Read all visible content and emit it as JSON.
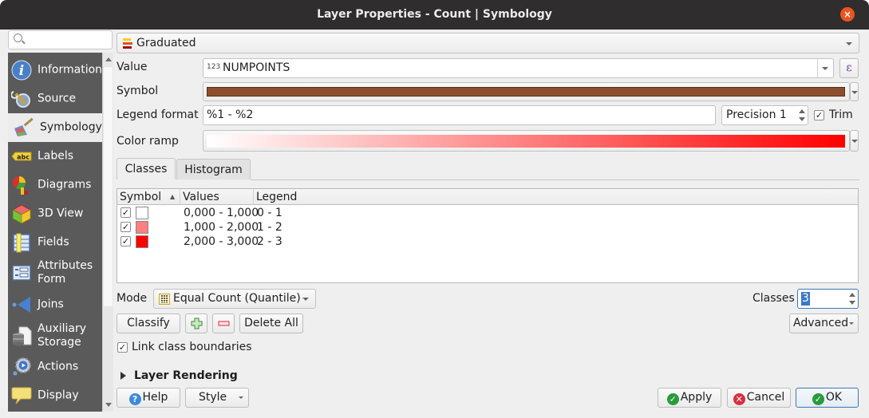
{
  "window": {
    "title": "Layer Properties - Count | Symbology",
    "close_icon": "×"
  },
  "sidebar": {
    "search_placeholder": "",
    "items": [
      {
        "label": "Information",
        "icon": "information-icon"
      },
      {
        "label": "Source",
        "icon": "source-icon"
      },
      {
        "label": "Symbology",
        "icon": "symbology-icon",
        "active": true
      },
      {
        "label": "Labels",
        "icon": "labels-icon"
      },
      {
        "label": "Diagrams",
        "icon": "diagrams-icon"
      },
      {
        "label": "3D View",
        "icon": "3d-view-icon"
      },
      {
        "label": "Fields",
        "icon": "fields-icon"
      },
      {
        "label": "Attributes\nForm",
        "icon": "attributes-form-icon"
      },
      {
        "label": "Joins",
        "icon": "joins-icon"
      },
      {
        "label": "Auxiliary\nStorage",
        "icon": "auxiliary-storage-icon"
      },
      {
        "label": "Actions",
        "icon": "actions-icon"
      },
      {
        "label": "Display",
        "icon": "display-icon"
      }
    ]
  },
  "renderer": {
    "type": "Graduated",
    "value_label": "Value",
    "value_prefix": "123",
    "value": "NUMPOINTS",
    "expression_icon": "ε",
    "symbol_label": "Symbol",
    "symbol_color": "#8b4f2e",
    "legend_format_label": "Legend format",
    "legend_format": "%1 - %2",
    "precision_text": "Precision 1",
    "trim_label": "Trim",
    "trim_checked": true,
    "color_ramp_label": "Color ramp",
    "color_ramp": {
      "start": "#ffffff",
      "end": "#ff0000"
    }
  },
  "tabs": [
    {
      "label": "Classes",
      "active": true
    },
    {
      "label": "Histogram",
      "active": false
    }
  ],
  "classes_table": {
    "columns": [
      "Symbol",
      "Values",
      "Legend"
    ],
    "sort_indicator": "▲",
    "rows": [
      {
        "checked": true,
        "color": "#ffffff",
        "values": "0,000 - 1,000",
        "legend": "0 - 1"
      },
      {
        "checked": true,
        "color": "#ff8080",
        "values": "1,000 - 2,000",
        "legend": "1 - 2"
      },
      {
        "checked": true,
        "color": "#ff0000",
        "values": "2,000 - 3,000",
        "legend": "2 - 3"
      }
    ]
  },
  "mode": {
    "label": "Mode",
    "value": "Equal Count (Quantile)"
  },
  "classes": {
    "label": "Classes",
    "value": "3"
  },
  "buttons": {
    "classify": "Classify",
    "add_class": "+",
    "remove_class": "−",
    "delete_all": "Delete All",
    "advanced": "Advanced",
    "help": "Help",
    "style": "Style",
    "apply": "Apply",
    "cancel": "Cancel",
    "ok": "OK"
  },
  "link_class_boundaries": {
    "label": "Link class boundaries",
    "checked": true
  },
  "layer_rendering": {
    "label": "Layer Rendering",
    "expanded": false
  }
}
